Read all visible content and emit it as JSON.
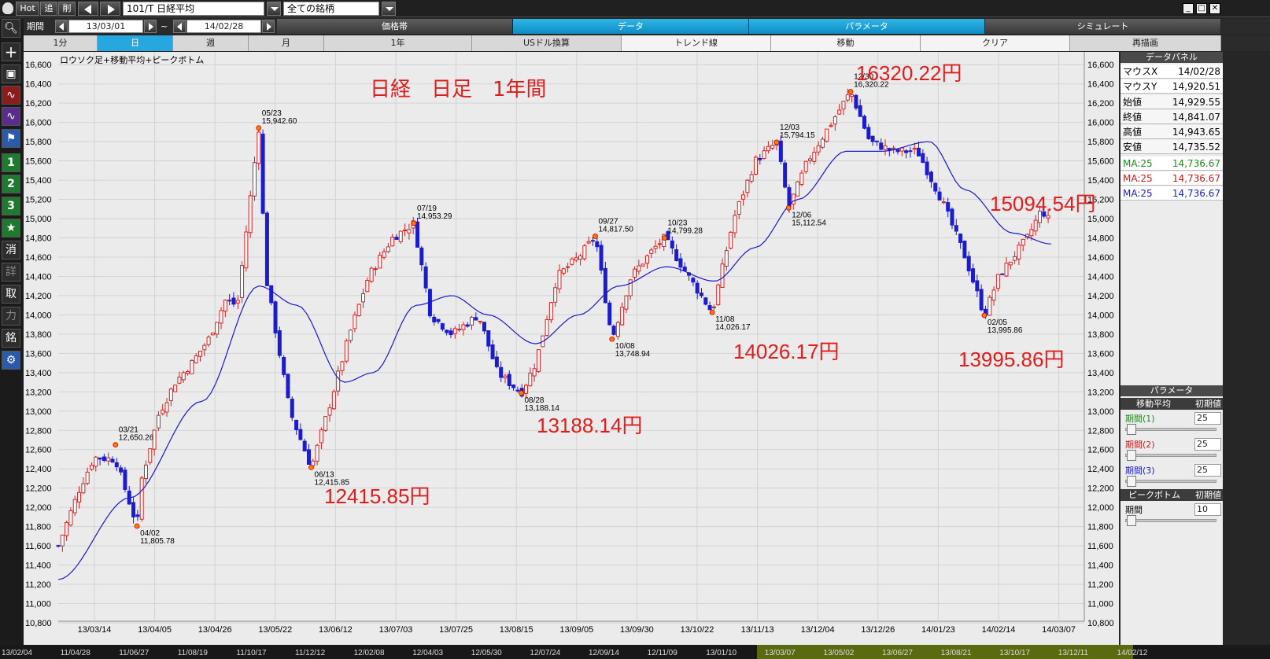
{
  "toolbar": {
    "hot": "Hot",
    "tsui": "追",
    "sakujo": "削",
    "symbol": "101/T 日経平均",
    "filter": "全ての銘柄"
  },
  "periodbar": {
    "label": "期間",
    "from": "13/03/01",
    "tilde": "~",
    "to": "14/02/28",
    "tabs": [
      "価格帯",
      "データ",
      "パラメータ",
      "シミュレート"
    ]
  },
  "rangebar": {
    "buttons": [
      "1分",
      "日",
      "週",
      "月",
      "1年",
      "USドル換算",
      "トレンド線",
      "移動",
      "クリア",
      "再描画"
    ]
  },
  "sidebar": {
    "buttons": [
      "1",
      "2",
      "3",
      "消",
      "詳",
      "取",
      "力",
      "銘"
    ]
  },
  "chart_data": {
    "type": "candlestick",
    "subtitle": "ロウソク足+移動平均+ピークボトム",
    "ylim": [
      10800,
      16700
    ],
    "yticks": [
      "16,600",
      "16,400",
      "16,200",
      "16,000",
      "15,800",
      "15,600",
      "15,400",
      "15,200",
      "15,000",
      "14,800",
      "14,600",
      "14,400",
      "14,200",
      "14,000",
      "13,800",
      "13,600",
      "13,400",
      "13,200",
      "13,000",
      "12,800",
      "12,600",
      "12,400",
      "12,200",
      "12,000",
      "11,800",
      "11,600",
      "11,400",
      "11,200",
      "11,000",
      "10,800"
    ],
    "xticks": [
      "13/03/14",
      "13/04/05",
      "13/04/26",
      "13/05/22",
      "13/06/12",
      "13/07/03",
      "13/07/25",
      "13/08/15",
      "13/09/05",
      "13/09/30",
      "13/10/22",
      "13/11/13",
      "13/12/04",
      "13/12/26",
      "14/01/23",
      "14/02/14",
      "14/03/07"
    ],
    "bottom_ticks": [
      "13/02/04",
      "11/04/28",
      "11/06/27",
      "11/08/19",
      "11/10/17",
      "11/12/12",
      "12/02/08",
      "12/04/03",
      "12/05/30",
      "12/07/24",
      "12/09/14",
      "12/11/09",
      "13/01/10",
      "13/03/07",
      "13/05/02",
      "13/06/27",
      "13/08/21",
      "13/10/17",
      "13/12/11",
      "14/02/12"
    ],
    "overlay_text": {
      "title": "日経　日足　1年間",
      "peaks": [
        "16320.22円",
        "15094.54円",
        "14026.17円",
        "13188.14円",
        "12415.85円",
        "13995.86円"
      ]
    },
    "annotations": [
      {
        "date": "04/02",
        "value": "11,805.78"
      },
      {
        "date": "03/21",
        "value": "12,650.26"
      },
      {
        "date": "05/23",
        "value": "15,942.60"
      },
      {
        "date": "06/13",
        "value": "12,415.85"
      },
      {
        "date": "07/19",
        "value": "14,953.29"
      },
      {
        "date": "08/28",
        "value": "13,188.14"
      },
      {
        "date": "09/27",
        "value": "14,817.50"
      },
      {
        "date": "10/08",
        "value": "13,748.94"
      },
      {
        "date": "10/23",
        "value": "14,799.28"
      },
      {
        "date": "11/08",
        "value": "14,026.17"
      },
      {
        "date": "12/03",
        "value": "15,794.15"
      },
      {
        "date": "12/06",
        "value": "15,112.54"
      },
      {
        "date": "12/30",
        "value": "16,320.22"
      },
      {
        "date": "02/05",
        "value": "13,995.86"
      }
    ],
    "series": [
      {
        "name": "ロウソク足",
        "points": [
          [
            0,
            11600
          ],
          [
            9,
            12200
          ],
          [
            15,
            12520
          ],
          [
            24,
            12500
          ],
          [
            33,
            11805
          ],
          [
            35,
            12300
          ],
          [
            42,
            12960
          ],
          [
            49,
            13300
          ],
          [
            56,
            13500
          ],
          [
            63,
            13750
          ],
          [
            70,
            14150
          ],
          [
            75,
            14100
          ],
          [
            84,
            15940
          ],
          [
            87,
            14400
          ],
          [
            97,
            13000
          ],
          [
            106,
            12415
          ],
          [
            113,
            13000
          ],
          [
            122,
            13800
          ],
          [
            130,
            14400
          ],
          [
            140,
            14800
          ],
          [
            149,
            14950
          ],
          [
            156,
            14000
          ],
          [
            165,
            13800
          ],
          [
            176,
            14000
          ],
          [
            184,
            13400
          ],
          [
            194,
            13188
          ],
          [
            200,
            13500
          ],
          [
            209,
            14400
          ],
          [
            218,
            14600
          ],
          [
            225,
            14817
          ],
          [
            232,
            13748
          ],
          [
            240,
            14400
          ],
          [
            250,
            14700
          ],
          [
            254,
            14799
          ],
          [
            264,
            14400
          ],
          [
            274,
            14026
          ],
          [
            283,
            15000
          ],
          [
            292,
            15600
          ],
          [
            301,
            15794
          ],
          [
            306,
            15112
          ],
          [
            314,
            15600
          ],
          [
            324,
            16000
          ],
          [
            332,
            16320
          ],
          [
            340,
            15800
          ],
          [
            350,
            15700
          ],
          [
            360,
            15700
          ],
          [
            370,
            15200
          ],
          [
            380,
            14600
          ],
          [
            388,
            13995
          ],
          [
            394,
            14400
          ],
          [
            400,
            14600
          ],
          [
            406,
            14800
          ],
          [
            412,
            15094
          ],
          [
            416,
            14950
          ]
        ]
      },
      {
        "name": "MA:25",
        "points": [
          [
            0,
            11250
          ],
          [
            30,
            12100
          ],
          [
            60,
            13100
          ],
          [
            84,
            14300
          ],
          [
            100,
            14100
          ],
          [
            120,
            13300
          ],
          [
            132,
            13400
          ],
          [
            150,
            14100
          ],
          [
            165,
            14200
          ],
          [
            180,
            14000
          ],
          [
            200,
            13700
          ],
          [
            218,
            14000
          ],
          [
            235,
            14300
          ],
          [
            255,
            14500
          ],
          [
            275,
            14350
          ],
          [
            292,
            14700
          ],
          [
            310,
            15200
          ],
          [
            330,
            15700
          ],
          [
            345,
            15700
          ],
          [
            365,
            15800
          ],
          [
            380,
            15300
          ],
          [
            400,
            14850
          ],
          [
            416,
            14736
          ]
        ]
      }
    ]
  },
  "data_panel": {
    "header": "データパネル",
    "rows": [
      {
        "label": "マウスX",
        "value": "14/02/28"
      },
      {
        "label": "マウスY",
        "value": "14,920.51"
      },
      {
        "label": "始値",
        "value": "14,929.55"
      },
      {
        "label": "終値",
        "value": "14,841.07"
      },
      {
        "label": "高値",
        "value": "14,943.65"
      },
      {
        "label": "安値",
        "value": "14,735.52"
      }
    ],
    "ma_rows": [
      {
        "label": "MA:25",
        "value": "14,736.67",
        "color": "#1a8a1a"
      },
      {
        "label": "MA:25",
        "value": "14,736.67",
        "color": "#d01818"
      },
      {
        "label": "MA:25",
        "value": "14,736.67",
        "color": "#1a1ad0"
      }
    ],
    "param_header": "パラメータ",
    "ma_section": {
      "label": "移動平均",
      "reset": "初期値"
    },
    "periods": [
      {
        "label": "期間(1)",
        "value": "25",
        "color": "#1a8a1a"
      },
      {
        "label": "期間(2)",
        "value": "25",
        "color": "#d01818"
      },
      {
        "label": "期間(3)",
        "value": "25",
        "color": "#1a1ad0"
      }
    ],
    "peak_section": {
      "label": "ピークボトム",
      "reset": "初期値"
    },
    "peak_period": {
      "label": "期間",
      "value": "10"
    }
  }
}
